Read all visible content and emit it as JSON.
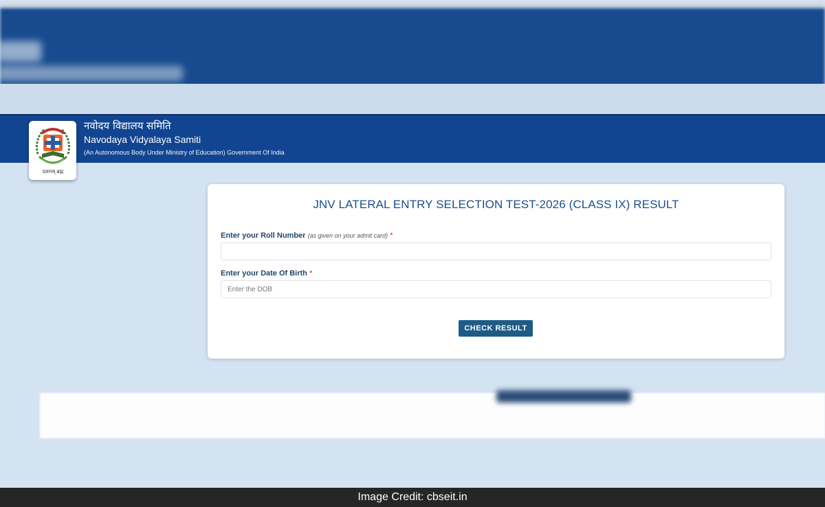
{
  "header": {
    "hindi_name": "नवोदय विद्यालय समिति",
    "org_name": "Navodaya Vidyalaya Samiti",
    "subtitle": "(An Autonomous Body Under Ministry of Education) Government Of India",
    "logo_text": "प्रज्ञानम् ब्रह्म"
  },
  "form": {
    "title": "JNV LATERAL ENTRY SELECTION TEST-2026 (CLASS IX) RESULT",
    "roll_label": "Enter your Roll Number",
    "roll_hint": "(as given on your admit card)",
    "roll_value": "",
    "dob_label": "Enter your Date Of Birth",
    "dob_placeholder": "Enter the DOB",
    "required_mark": "*",
    "submit_label": "CHECK RESULT"
  },
  "credit": "Image Credit: cbseit.in",
  "colors": {
    "header_bg": "#124591",
    "page_bg": "#d4e3f2",
    "title": "#1a4f8b",
    "button": "#1d5c87",
    "required": "#d9252c",
    "credit_bg": "#262626"
  }
}
